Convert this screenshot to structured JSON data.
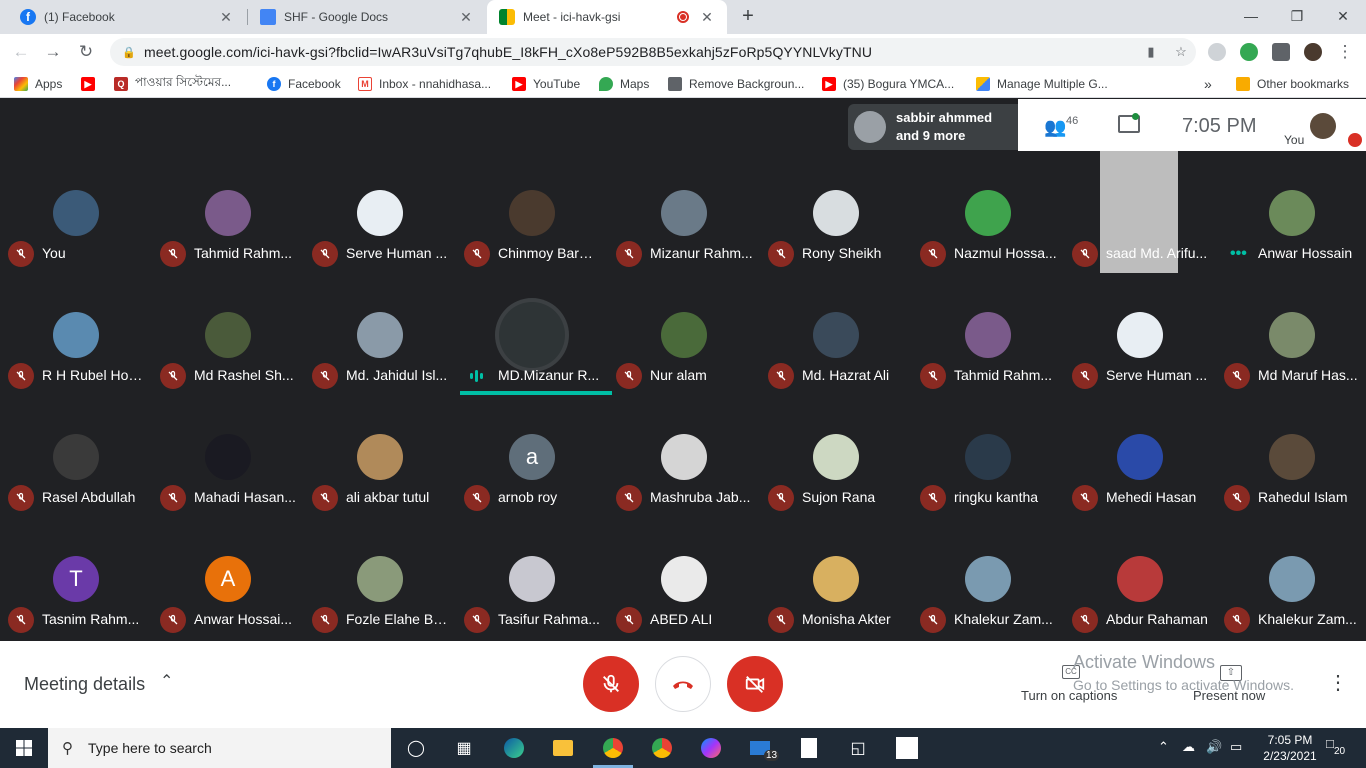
{
  "browser": {
    "tabs": [
      {
        "title": "(1) Facebook",
        "favicon": "facebook-icon",
        "active": false
      },
      {
        "title": "SHF - Google Docs",
        "favicon": "google-docs-icon",
        "active": false
      },
      {
        "title": "Meet - ici-havk-gsi",
        "favicon": "google-meet-icon",
        "active": true
      }
    ],
    "new_tab_label": "+",
    "url": "meet.google.com/ici-havk-gsi?fbclid=IwAR3uVsiTg7qhubE_I8kFH_cXo8eP592B8B5exkahj5zFoRp5QYYNLVkyTNU",
    "bookmarks": [
      {
        "label": "Apps",
        "icon": "apps-grid-icon"
      },
      {
        "label": "",
        "icon": "youtube-icon"
      },
      {
        "label": "পাওয়ার সিস্টেমের...",
        "icon": "quora-icon"
      },
      {
        "label": "Facebook",
        "icon": "facebook-icon"
      },
      {
        "label": "Inbox - nnahidhasa...",
        "icon": "gmail-icon"
      },
      {
        "label": "YouTube",
        "icon": "youtube-icon"
      },
      {
        "label": "Maps",
        "icon": "maps-icon"
      },
      {
        "label": "Remove Backgroun...",
        "icon": "remove-bg-icon"
      },
      {
        "label": "(35) Bogura YMCA...",
        "icon": "youtube-icon"
      },
      {
        "label": "Manage Multiple G...",
        "icon": "google-ads-icon"
      }
    ],
    "bookmarks_more": "»",
    "other_bookmarks": "Other bookmarks"
  },
  "meet": {
    "notification": {
      "line1": "sabbir ahmmed",
      "line2": "and 9 more"
    },
    "people_count": "46",
    "time": "7:05 PM",
    "you_label": "You",
    "participants": [
      {
        "name": "You",
        "avatar": "photo",
        "color": "#3b5a78"
      },
      {
        "name": "Tahmid Rahm...",
        "avatar": "photo",
        "color": "#7a5a8a"
      },
      {
        "name": "Serve Human ...",
        "avatar": "logo",
        "color": "#e8eef3"
      },
      {
        "name": "Chinmoy Barm...",
        "avatar": "photo",
        "color": "#4a3a2e"
      },
      {
        "name": "Mizanur Rahm...",
        "avatar": "photo",
        "color": "#6a7a88"
      },
      {
        "name": "Rony Sheikh",
        "avatar": "photo",
        "color": "#d8dde0"
      },
      {
        "name": "Nazmul Hossa...",
        "avatar": "photo",
        "color": "#3fa34d"
      },
      {
        "name": "saad Md. Arifu...",
        "avatar": "video",
        "color": "#bdbdbd"
      },
      {
        "name": "Anwar Hossain",
        "avatar": "photo",
        "color": "#6b8a5a"
      },
      {
        "name": "R H Rubel Hos...",
        "avatar": "photo",
        "color": "#5a8ab0"
      },
      {
        "name": "Md Rashel Sh...",
        "avatar": "photo",
        "color": "#4a5a3a"
      },
      {
        "name": "Md. Jahidul Isl...",
        "avatar": "photo",
        "color": "#8a9aa8"
      },
      {
        "name": "MD.Mizanur R...",
        "avatar": "photo",
        "color": "#2e3436"
      },
      {
        "name": "Nur alam",
        "avatar": "photo",
        "color": "#4a6a3a"
      },
      {
        "name": "Md. Hazrat Ali",
        "avatar": "photo",
        "color": "#3a4a5a"
      },
      {
        "name": "Tahmid Rahm...",
        "avatar": "photo",
        "color": "#7a5a8a"
      },
      {
        "name": "Serve Human ...",
        "avatar": "logo",
        "color": "#e8eef3"
      },
      {
        "name": "Md Maruf Has...",
        "avatar": "photo",
        "color": "#7a8a6a"
      },
      {
        "name": "Rasel Abdullah",
        "avatar": "photo",
        "color": "#3a3a3a"
      },
      {
        "name": "Mahadi Hasan...",
        "avatar": "photo",
        "color": "#1a1a22"
      },
      {
        "name": "ali akbar tutul",
        "avatar": "photo",
        "color": "#b08a5a"
      },
      {
        "name": "arnob roy",
        "avatar": "letter",
        "letter": "a",
        "color": "#5f6e7a"
      },
      {
        "name": "Mashruba Jab...",
        "avatar": "photo",
        "color": "#d5d5d5"
      },
      {
        "name": "Sujon Rana",
        "avatar": "photo",
        "color": "#cdd8c2"
      },
      {
        "name": "ringku kantha",
        "avatar": "photo",
        "color": "#2a3a4a"
      },
      {
        "name": "Mehedi Hasan",
        "avatar": "photo",
        "color": "#2a4aa8"
      },
      {
        "name": "Rahedul Islam",
        "avatar": "photo",
        "color": "#5a4a3a"
      },
      {
        "name": "Tasnim Rahm...",
        "avatar": "letter",
        "letter": "T",
        "color": "#6a3aa8"
      },
      {
        "name": "Anwar Hossai...",
        "avatar": "letter",
        "letter": "A",
        "color": "#e8710a"
      },
      {
        "name": "Fozle Elahe Ba...",
        "avatar": "photo",
        "color": "#8a9a7a"
      },
      {
        "name": "Tasifur Rahma...",
        "avatar": "photo",
        "color": "#c8c8d0"
      },
      {
        "name": "ABED ALI",
        "avatar": "photo",
        "color": "#eaeaea"
      },
      {
        "name": "Monisha Akter",
        "avatar": "photo",
        "color": "#d8b060"
      },
      {
        "name": "Khalekur Zam...",
        "avatar": "photo",
        "color": "#7a9ab0"
      },
      {
        "name": "Abdur Rahaman",
        "avatar": "photo",
        "color": "#b83a3a"
      },
      {
        "name": "Khalekur Zam...",
        "avatar": "photo",
        "color": "#7a9ab0"
      }
    ],
    "speaking_index": 12,
    "more_options_index": 8,
    "meeting_details": "Meeting details",
    "captions_label": "Turn on captions",
    "present_label": "Present now",
    "watermark_line1": "Activate Windows",
    "watermark_line2": "Go to Settings to activate Windows.",
    "accent_red": "#d93025"
  },
  "taskbar": {
    "search_placeholder": "Type here to search",
    "time": "7:05 PM",
    "date": "2/23/2021",
    "mail_badge": "13",
    "notif_badge": "20"
  }
}
